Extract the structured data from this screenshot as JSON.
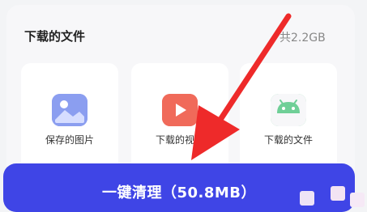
{
  "section": {
    "title": "下载的文件",
    "total_size": "共2.2GB"
  },
  "tiles": [
    {
      "label": "保存的图片",
      "icon": "image-icon",
      "color": "#7b8fe6"
    },
    {
      "label": "下载的视频",
      "icon": "video-play-icon",
      "color": "#f06a5a"
    },
    {
      "label": "下载的文件",
      "icon": "android-icon",
      "color": "#6fcf97"
    }
  ],
  "clean_button": {
    "label": "一键清理（50.8MB）"
  },
  "colors": {
    "accent": "#3f45e6",
    "arrow": "#ee2a2a"
  }
}
